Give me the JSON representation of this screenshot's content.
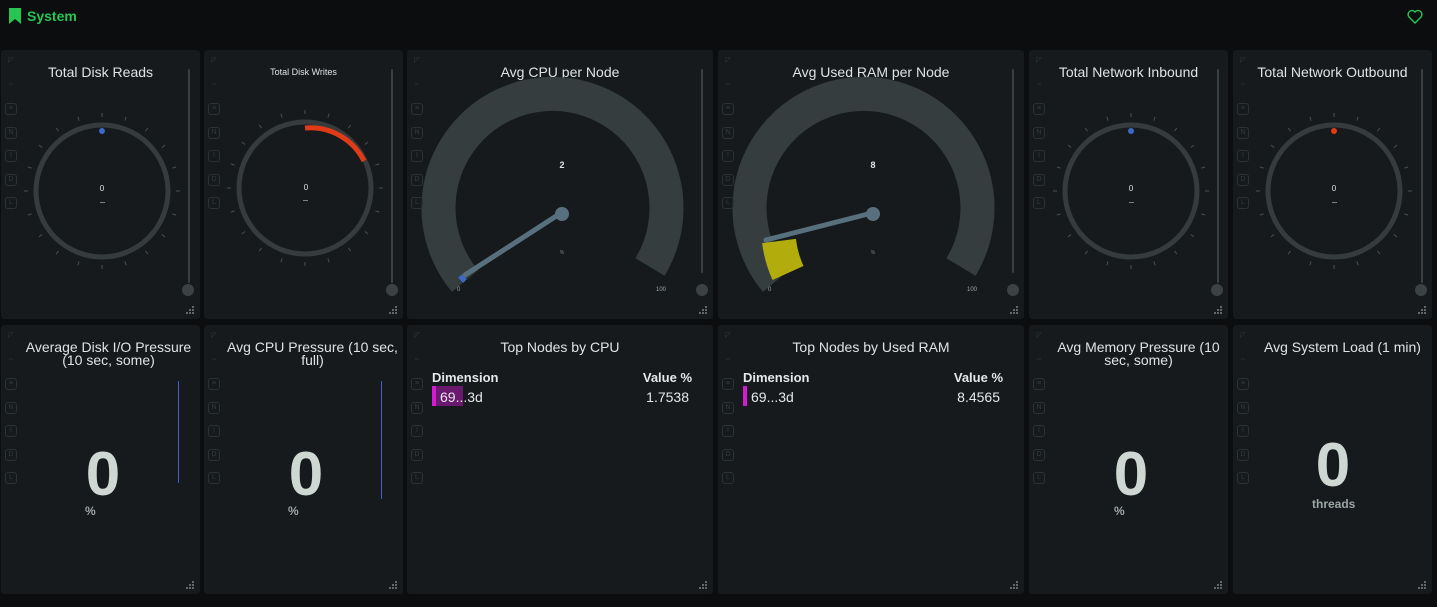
{
  "section": {
    "title": "System",
    "bookmark_icon": "bookmark-icon",
    "heart_icon": "heart-icon",
    "accent": "#27c650"
  },
  "panels": {
    "disk_reads": {
      "title": "Total Disk Reads",
      "value": "0",
      "unit": "—",
      "indicator_color": "#3d67c9"
    },
    "disk_writes": {
      "title": "Total Disk Writes",
      "value": "0",
      "unit": "—",
      "indicator_color": "#e23a17"
    },
    "cpu_node": {
      "title": "Avg CPU per Node",
      "value": "2",
      "unit": "%",
      "min": "0",
      "max": "100",
      "fill_fraction": 0.02,
      "fill_color": "#3d67c9"
    },
    "ram_node": {
      "title": "Avg Used RAM per Node",
      "value": "8",
      "unit": "%",
      "min": "0",
      "max": "100",
      "fill_fraction": 0.085,
      "fill_color": "#b2ad0d"
    },
    "net_in": {
      "title": "Total Network Inbound",
      "value": "0",
      "unit": "—",
      "indicator_color": "#3d67c9"
    },
    "net_out": {
      "title": "Total Network Outbound",
      "value": "0",
      "unit": "—",
      "indicator_color": "#e23a17"
    },
    "disk_io_pressure": {
      "title": "Average Disk I/O Pressure (10 sec, some)",
      "value": "0",
      "unit": "%"
    },
    "cpu_pressure": {
      "title": "Avg CPU Pressure (10 sec, full)",
      "value": "0",
      "unit": "%"
    },
    "top_cpu": {
      "title": "Top Nodes by CPU",
      "col_dim": "Dimension",
      "col_val": "Value %",
      "row_dim": "69...3d",
      "row_val": "1.7538",
      "bar_color": "#d21bd2"
    },
    "top_ram": {
      "title": "Top Nodes by Used RAM",
      "col_dim": "Dimension",
      "col_val": "Value %",
      "row_dim": "69...3d",
      "row_val": "8.4565",
      "bar_color": "#d21bd2"
    },
    "mem_pressure": {
      "title": "Avg Memory Pressure (10 sec, some)",
      "value": "0",
      "unit": "%"
    },
    "sys_load": {
      "title": "Avg System Load (1 min)",
      "value": "0",
      "unit": "threads"
    }
  }
}
